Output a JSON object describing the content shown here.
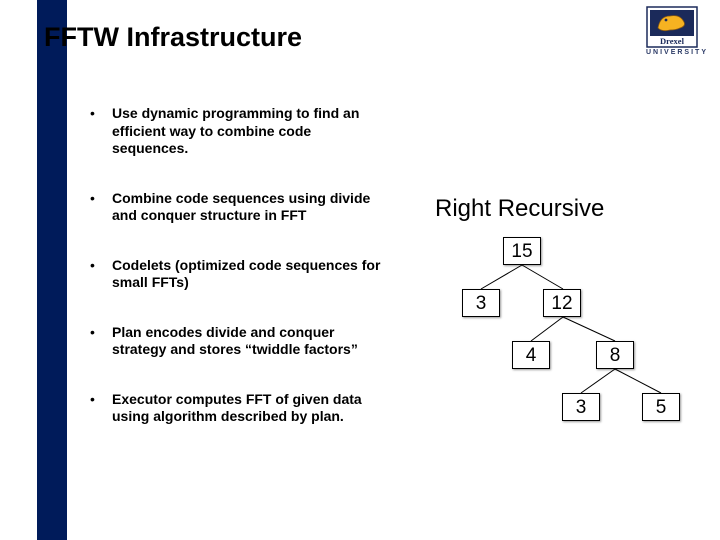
{
  "title": "FFTW Infrastructure",
  "logo": {
    "name": "Drexel",
    "caption": "UNIVERSITY"
  },
  "bullets": {
    "b1": "Use dynamic programming to find an efficient way to combine code sequences.",
    "b2": "Combine code sequences using divide and conquer structure in FFT",
    "b3": "Codelets (optimized code sequences for small FFTs)",
    "b4": "Plan encodes divide and conquer strategy and stores “twiddle factors”",
    "b5": "Executor computes FFT of given data using algorithm described by plan."
  },
  "tree": {
    "title": "Right Recursive",
    "nodes": {
      "n15": "15",
      "n3": "3",
      "n12": "12",
      "n4": "4",
      "n8": "8",
      "n3b": "3",
      "n5": "5"
    }
  },
  "chart_data": {
    "type": "tree",
    "title": "Right Recursive",
    "nodes": [
      {
        "id": "n15",
        "value": 15
      },
      {
        "id": "n3",
        "value": 3
      },
      {
        "id": "n12",
        "value": 12
      },
      {
        "id": "n4",
        "value": 4
      },
      {
        "id": "n8",
        "value": 8
      },
      {
        "id": "n3b",
        "value": 3
      },
      {
        "id": "n5",
        "value": 5
      }
    ],
    "edges": [
      [
        "n15",
        "n3"
      ],
      [
        "n15",
        "n12"
      ],
      [
        "n12",
        "n4"
      ],
      [
        "n12",
        "n8"
      ],
      [
        "n8",
        "n3b"
      ],
      [
        "n8",
        "n5"
      ]
    ]
  }
}
